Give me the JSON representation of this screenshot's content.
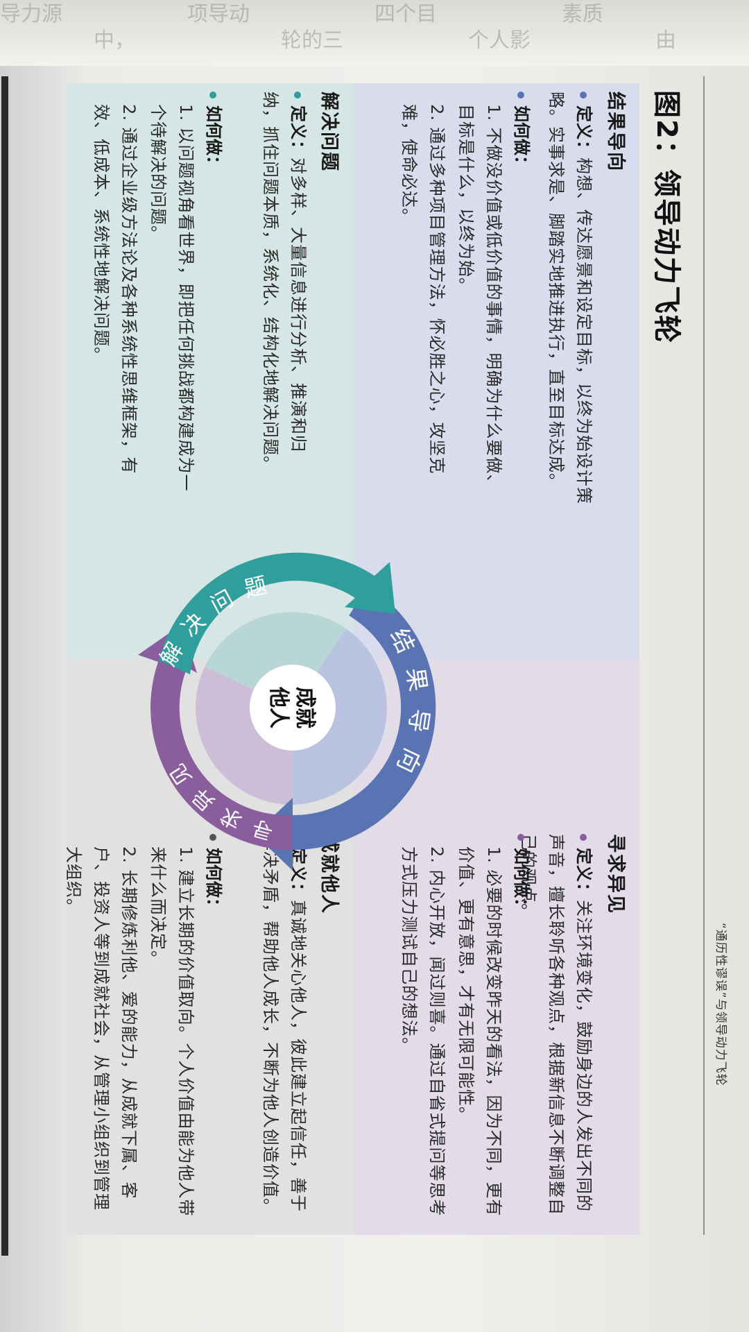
{
  "running_header": "“通历性谬误”与领导动力飞轮",
  "figure_title": "图2：领导动力飞轮",
  "edge_fragments": [
    "导力源",
    "中，",
    "项导动",
    "轮的三",
    "四个目",
    "个人影",
    "素质",
    "由"
  ],
  "quadrants": {
    "results": {
      "title": "结果导向",
      "definition_label": "定义：",
      "definition": "构想、传达愿景和设定目标，以终为始设计策略。实事求是、脚踏实地推进执行，直至目标达成。",
      "how_label": "如何做：",
      "steps": [
        "1. 不做没价值或低价值的事情，明确为什么要做、目标是什么，以终为始。",
        "2. 通过多种项目管理方法，怀必胜之心，攻坚克难，使命必达。"
      ],
      "color": "#5a74b3"
    },
    "insight": {
      "title": "寻求异见",
      "definition_label": "定义：",
      "definition": "关注环境变化，鼓励身边的人发出不同的声音，擅长聆听各种观点，根据新信息不断调整自己的观点。",
      "how_label": "如何做：",
      "steps": [
        "1. 必要的时候改变昨天的看法，因为不同，更有价值、更有意思，才有无限可能性。",
        "2. 内心开放，闻过则喜。通过自省式提问等思考方式压力测试自己的想法。"
      ],
      "color": "#8a5d9c"
    },
    "solve": {
      "title": "解决问题",
      "definition_label": "定义：",
      "definition": "对多样、大量信息进行分析、推演和归纳，抓住问题本质，系统化、结构化地解决问题。",
      "how_label": "如何做：",
      "steps": [
        "1. 以问题视角看世界，即把任何挑战都构建成为一个待解决的问题。",
        "2. 通过企业级方法论及各种系统性思维框架，有效、低成本、系统性地解决问题。"
      ],
      "color": "#2f9e9c"
    },
    "others": {
      "title": "成就他人",
      "definition_label": "定义：",
      "definition": "真诚地关心他人，彼此建立起信任，善于解决矛盾，帮助他人成长，不断为他人创造价值。",
      "how_label": "如何做：",
      "steps": [
        "1. 建立长期的价值取向。个人价值由能为他人带来什么而决定。",
        "2. 长期修炼利他、爱的能力，从成就下属、客户、投资人等到成就社会，从管理小组织到管理大组织。"
      ]
    }
  },
  "wheel": {
    "center_line1": "成就",
    "center_line2": "他人",
    "arc_results": "结果导向",
    "arc_insight": "寻求异见",
    "arc_solve": "解决问题",
    "color_results": "#5a74b3",
    "color_insight": "#8a5d9c",
    "color_solve": "#2f9e9c"
  }
}
